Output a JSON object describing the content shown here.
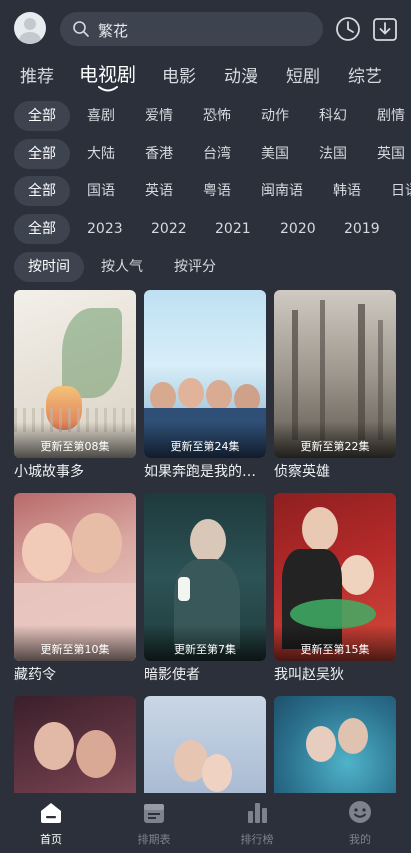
{
  "header": {
    "search_text": "繁花",
    "icons": [
      "avatar",
      "search-icon",
      "history-clock-icon",
      "download-icon"
    ]
  },
  "tabs": [
    {
      "label": "推荐",
      "active": false
    },
    {
      "label": "电视剧",
      "active": true
    },
    {
      "label": "电影",
      "active": false
    },
    {
      "label": "动漫",
      "active": false
    },
    {
      "label": "短剧",
      "active": false
    },
    {
      "label": "综艺",
      "active": false
    }
  ],
  "filters": {
    "genre": [
      "全部",
      "喜剧",
      "爱情",
      "恐怖",
      "动作",
      "科幻",
      "剧情"
    ],
    "region": [
      "全部",
      "大陆",
      "香港",
      "台湾",
      "美国",
      "法国",
      "英国"
    ],
    "language": [
      "全部",
      "国语",
      "英语",
      "粤语",
      "闽南语",
      "韩语",
      "日语"
    ],
    "year": [
      "全部",
      "2023",
      "2022",
      "2021",
      "2020",
      "2019"
    ],
    "sort": [
      "按时间",
      "按人气",
      "按评分"
    ]
  },
  "shows": [
    {
      "title": "小城故事多",
      "badge": "更新至第08集"
    },
    {
      "title": "如果奔跑是我的人生",
      "badge": "更新至第24集"
    },
    {
      "title": "侦察英雄",
      "badge": "更新至第22集"
    },
    {
      "title": "藏药令",
      "badge": "更新至第10集"
    },
    {
      "title": "暗影使者",
      "badge": "更新至第7集"
    },
    {
      "title": "我叫赵吴狄",
      "badge": "更新至第15集"
    },
    {
      "title": "",
      "badge": ""
    },
    {
      "title": "",
      "badge": ""
    },
    {
      "title": "",
      "badge": ""
    }
  ],
  "bottom_nav": [
    {
      "label": "首页",
      "icon": "home-icon",
      "active": true
    },
    {
      "label": "排期表",
      "icon": "calendar-icon",
      "active": false
    },
    {
      "label": "排行榜",
      "icon": "bar-chart-icon",
      "active": false
    },
    {
      "label": "我的",
      "icon": "smile-icon",
      "active": false
    }
  ],
  "colors": {
    "background": "#2b303a",
    "chip_selected": "#3d4450",
    "text_primary": "#ffffff",
    "text_muted": "#7d838d"
  }
}
